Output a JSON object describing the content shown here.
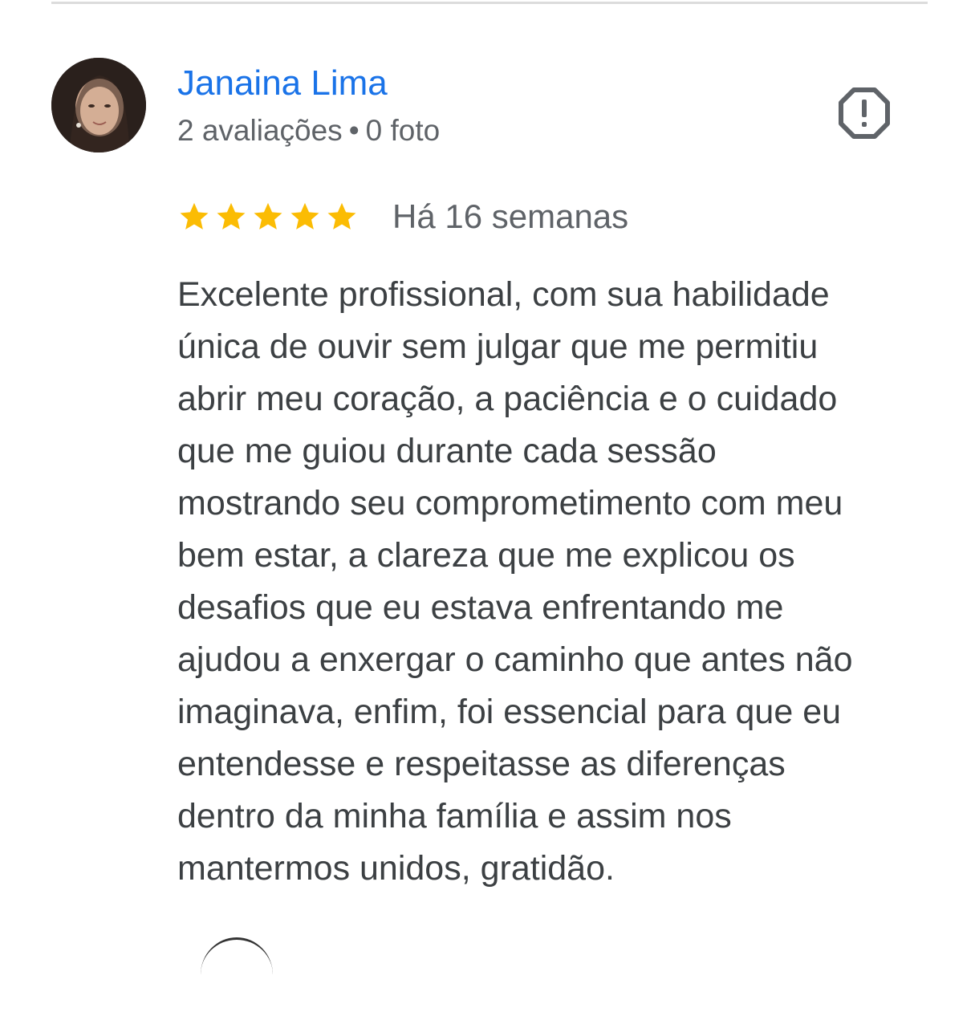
{
  "review": {
    "reviewer": {
      "name": "Janaina Lima",
      "reviews_count": "2 avaliações",
      "separator": "•",
      "photos_count": "0 foto",
      "avatar": "reviewer-photo"
    },
    "report_icon": "report-flag-icon",
    "rating": {
      "stars": 5,
      "max_stars": 5,
      "star_color": "#fbbc04"
    },
    "date": "Há 16 semanas",
    "text_lines": [
      "Excelente profissional, com sua habilidade",
      "única de ouvir sem julgar que me permitiu",
      "abrir meu coração, a paciência e o cuidado",
      "que me guiou durante cada sessão",
      "mostrando seu comprometimento com meu",
      "bem estar, a clareza que me explicou os",
      "desafios que eu estava enfrentando me",
      "ajudou a enxergar o caminho que antes não",
      "imaginava, enfim, foi essencial para que eu",
      "entendesse e respeitasse as diferenças",
      "dentro da minha família e assim nos",
      "mantermos unidos, gratidão."
    ]
  },
  "colors": {
    "name_link": "#1a73e8",
    "meta_text": "#5f6368",
    "body_text": "#3c4043",
    "divider": "#dcdcdc"
  }
}
